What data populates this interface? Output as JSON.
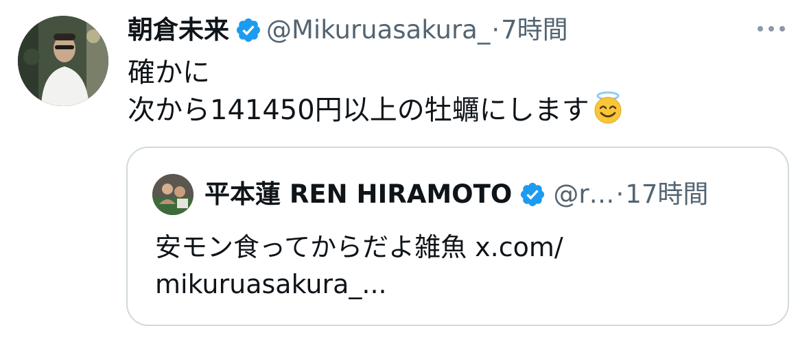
{
  "tweet": {
    "author": {
      "display_name": "朝倉未来",
      "handle": "@Mikuruasakura_",
      "verified": true
    },
    "separator": "·",
    "time": "7時間",
    "more_icon": "more-horizontal-icon",
    "text_lines": [
      "確かに",
      "次から141450円以上の牡蠣にします"
    ],
    "emoji": "smiling-face-with-halo"
  },
  "quote": {
    "author": {
      "display_name": "平本蓮 REN HIRAMOTO",
      "handle": "@r…",
      "verified": true
    },
    "separator": "·",
    "time": "17時間",
    "text_lines": [
      "安モン食ってからだよ雑魚 x.com/",
      "mikuruasakura_..."
    ]
  },
  "colors": {
    "verified": "#1d9bf0",
    "secondary_text": "#536471",
    "border": "#cfd9de",
    "primary_text": "#0f1419"
  }
}
